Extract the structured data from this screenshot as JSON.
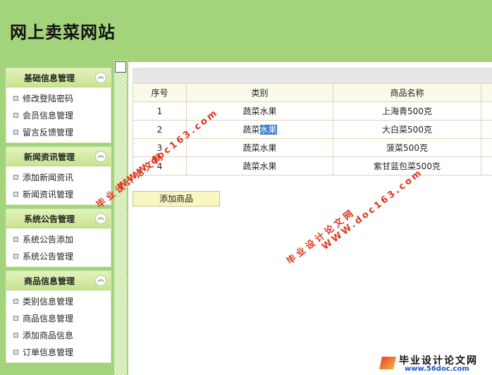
{
  "site": {
    "title": "网上卖菜网站"
  },
  "sidebar": {
    "collapse_glyph": "︽",
    "sections": [
      {
        "title": "基础信息管理",
        "items": [
          "修改登陆密码",
          "会员信息管理",
          "留言反馈管理"
        ]
      },
      {
        "title": "新闻资讯管理",
        "items": [
          "添加新闻资讯",
          "新闻资讯管理"
        ]
      },
      {
        "title": "系统公告管理",
        "items": [
          "系统公告添加",
          "系统公告管理"
        ]
      },
      {
        "title": "商品信息管理",
        "items": [
          "类别信息管理",
          "商品信息管理",
          "添加商品信息",
          "订单信息管理"
        ]
      }
    ]
  },
  "table": {
    "headers": [
      "序号",
      "类别",
      "商品名称"
    ],
    "rows": [
      {
        "id": "1",
        "category": "蔬菜水果",
        "name": "上海青500克"
      },
      {
        "id": "2",
        "category_plain": "蔬菜",
        "category_selected": "水果",
        "name": "大白菜500克"
      },
      {
        "id": "3",
        "category": "蔬菜水果",
        "name": "菠菜500克"
      },
      {
        "id": "4",
        "category": "蔬菜水果",
        "name": "紫甘蓝包菜500克"
      }
    ]
  },
  "add_button": "添加商品",
  "watermarks": {
    "url": "WWW.doc163.com",
    "name": "毕业设计论文网",
    "badge_title": "毕业设计论文网",
    "badge_url": "www.56doc.com"
  },
  "colors": {
    "header_bg": "#a3d37a",
    "watermark": "#e0351a",
    "selection": "#3a7bd5"
  }
}
